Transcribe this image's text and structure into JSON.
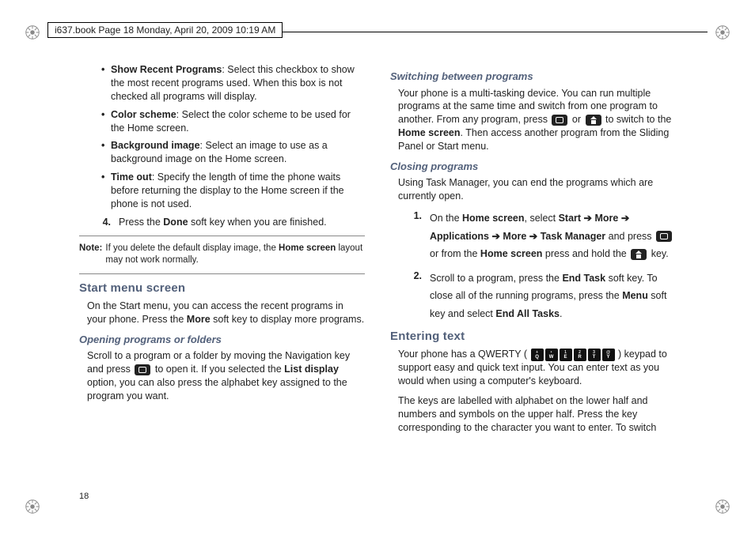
{
  "header": {
    "text": "i637.book  Page 18  Monday, April 20, 2009  10:19 AM"
  },
  "page_number": "18",
  "left": {
    "bullets": [
      {
        "title": "Show Recent Programs",
        "body": ": Select this checkbox to show the most recent programs used. When this box is not checked all programs will display."
      },
      {
        "title": "Color scheme",
        "body": ": Select the color scheme to be used for the Home screen."
      },
      {
        "title": "Background image",
        "body": ": Select an image to use as a background image on the Home screen."
      },
      {
        "title": "Time out",
        "body": ": Specify the length of time the phone waits before returning the display to the Home screen if the phone is not used."
      }
    ],
    "step4": {
      "num": "4.",
      "pre": "Press the ",
      "bold": "Done",
      "post": " soft key when you are finished."
    },
    "note": {
      "label": "Note:",
      "pre": " If you delete the default display image, the ",
      "bold": "Home screen",
      "post": " layout may not work normally."
    },
    "h2_start": "Start menu screen",
    "start_para": {
      "pre": "On the Start menu, you can access the recent programs in your phone. Press the ",
      "bold": "More",
      "post": " soft key to display more programs."
    },
    "h3_open": "Opening programs or folders",
    "open_para": {
      "pre": "Scroll to a program or a folder by moving the Navigation key and press ",
      "mid": " to open it. If you selected the ",
      "bold": "List display",
      "post": " option, you can also press the alphabet key assigned to the program you want."
    }
  },
  "right": {
    "h3_switch": "Switching between programs",
    "switch_para": {
      "p1": "Your phone is a multi-tasking device. You can run multiple programs at the same time and switch from one program to another. From any program, press ",
      "or": " or ",
      "p2": " to switch to the ",
      "bold": "Home screen",
      "p3": ". Then access another program from the Sliding Panel or Start menu."
    },
    "h3_close": "Closing programs",
    "close_intro": "Using Task Manager, you can end the programs which are currently open.",
    "close_steps": [
      {
        "num": "1.",
        "seg": [
          "On the ",
          "Home screen",
          ", select ",
          "Start ➔ More ➔ Applications ➔ More ➔ Task Manager",
          " and press ",
          " or from the ",
          "Home screen",
          " press and hold the ",
          " key."
        ]
      },
      {
        "num": "2.",
        "seg": [
          "Scroll to a program, press the ",
          "End Task",
          " soft key. To close all of the running programs, press the ",
          "Menu",
          " soft key and select ",
          "End All Tasks",
          "."
        ]
      }
    ],
    "h2_enter": "Entering text",
    "qwerty_keys": [
      {
        "top": "+",
        "bot": "Q"
      },
      {
        "top": "•",
        "bot": "W"
      },
      {
        "top": "1",
        "bot": "E"
      },
      {
        "top": "2",
        "bot": "R"
      },
      {
        "top": "3",
        "bot": "T"
      },
      {
        "top": "@",
        "bot": "Y"
      }
    ],
    "enter_p1a": "Your phone has a QWERTY ( ",
    "enter_p1b": " ) keypad to support easy and quick text input. You can enter text as you would when using a computer's keyboard.",
    "enter_p2": "The keys are labelled with alphabet on the lower half and numbers and symbols on the upper half. Press the key corresponding to the character you want to enter. To switch"
  }
}
